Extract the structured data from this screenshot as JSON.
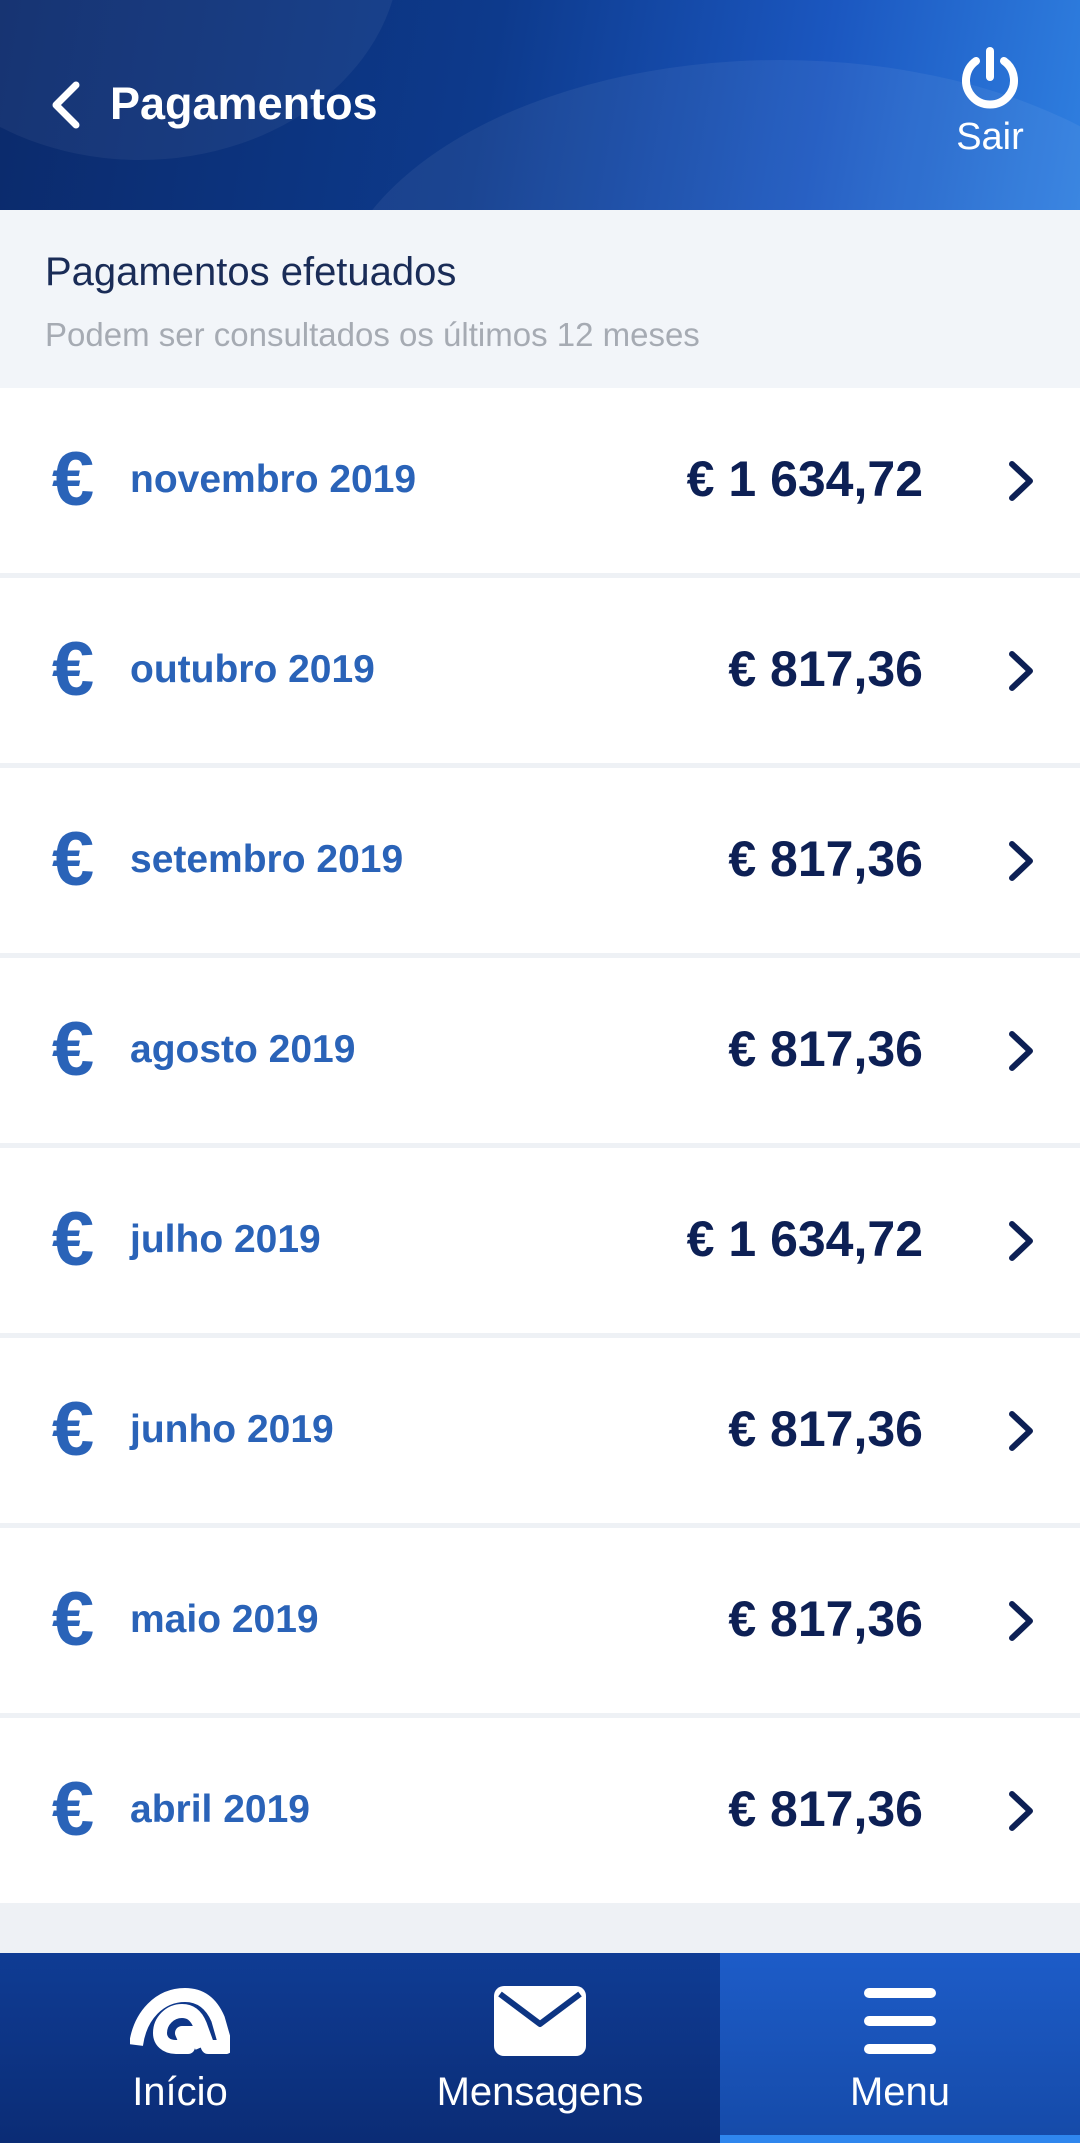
{
  "header": {
    "title": "Pagamentos",
    "logout_label": "Sair"
  },
  "section": {
    "title": "Pagamentos efetuados",
    "subtitle": "Podem ser consultados os últimos 12 meses"
  },
  "payments": [
    {
      "month": "novembro 2019",
      "amount": "€ 1 634,72"
    },
    {
      "month": "outubro 2019",
      "amount": "€ 817,36"
    },
    {
      "month": "setembro 2019",
      "amount": "€ 817,36"
    },
    {
      "month": "agosto 2019",
      "amount": "€ 817,36"
    },
    {
      "month": "julho 2019",
      "amount": "€ 1 634,72"
    },
    {
      "month": "junho 2019",
      "amount": "€ 817,36"
    },
    {
      "month": "maio 2019",
      "amount": "€ 817,36"
    },
    {
      "month": "abril 2019",
      "amount": "€ 817,36"
    }
  ],
  "euro_symbol": "€",
  "nav": {
    "items": [
      {
        "label": "Início",
        "icon": "home-logo-icon",
        "active": false
      },
      {
        "label": "Mensagens",
        "icon": "envelope-icon",
        "active": false
      },
      {
        "label": "Menu",
        "icon": "hamburger-menu-icon",
        "active": true
      }
    ]
  },
  "colors": {
    "header_dark": "#0b2a6b",
    "accent_blue": "#2a63b8",
    "amount_navy": "#0d2055",
    "nav_active": "#2f86ee"
  }
}
